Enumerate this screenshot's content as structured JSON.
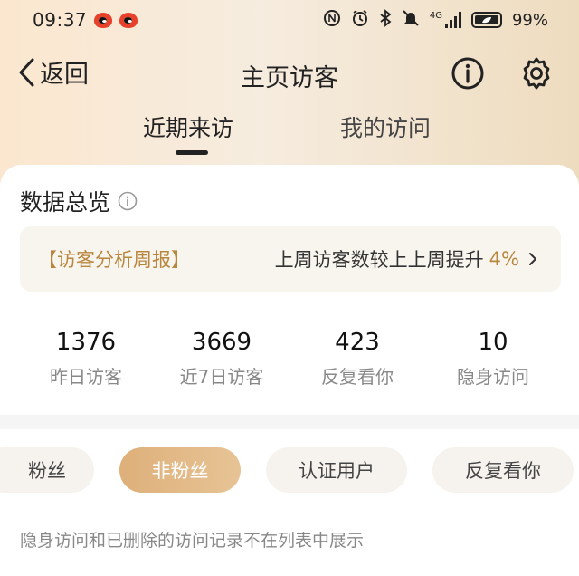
{
  "status_bar": {
    "time": "09:37",
    "network": "4G",
    "battery_text": "99%",
    "icons": [
      "weibo-icon",
      "weibo-icon",
      "nfc-icon",
      "alarm-icon",
      "bluetooth-icon",
      "mute-icon",
      "signal-icon",
      "battery-icon"
    ]
  },
  "nav": {
    "back_label": "返回",
    "title": "主页访客",
    "info_icon": "info-icon",
    "settings_icon": "gear-icon"
  },
  "tabs": [
    {
      "label": "近期来访",
      "active": true
    },
    {
      "label": "我的访问",
      "active": false
    }
  ],
  "overview": {
    "title": "数据总览",
    "banner": {
      "tag": "【访客分析周报】",
      "text": "上周访客数较上上周提升",
      "percent": "4%"
    },
    "stats": [
      {
        "value": "1376",
        "label": "昨日访客"
      },
      {
        "value": "3669",
        "label": "近7日访客"
      },
      {
        "value": "423",
        "label": "反复看你"
      },
      {
        "value": "10",
        "label": "隐身访问"
      }
    ]
  },
  "filters": {
    "chips": [
      {
        "label": "粉丝",
        "active": false
      },
      {
        "label": "非粉丝",
        "active": true
      },
      {
        "label": "认证用户",
        "active": false
      },
      {
        "label": "反复看你",
        "active": false
      }
    ],
    "note": "隐身访问和已删除的访问记录不在列表中展示"
  },
  "colors": {
    "accent": "#b8863d",
    "chip_active": "#deb07a",
    "header_bg": "#f6ecdf"
  }
}
